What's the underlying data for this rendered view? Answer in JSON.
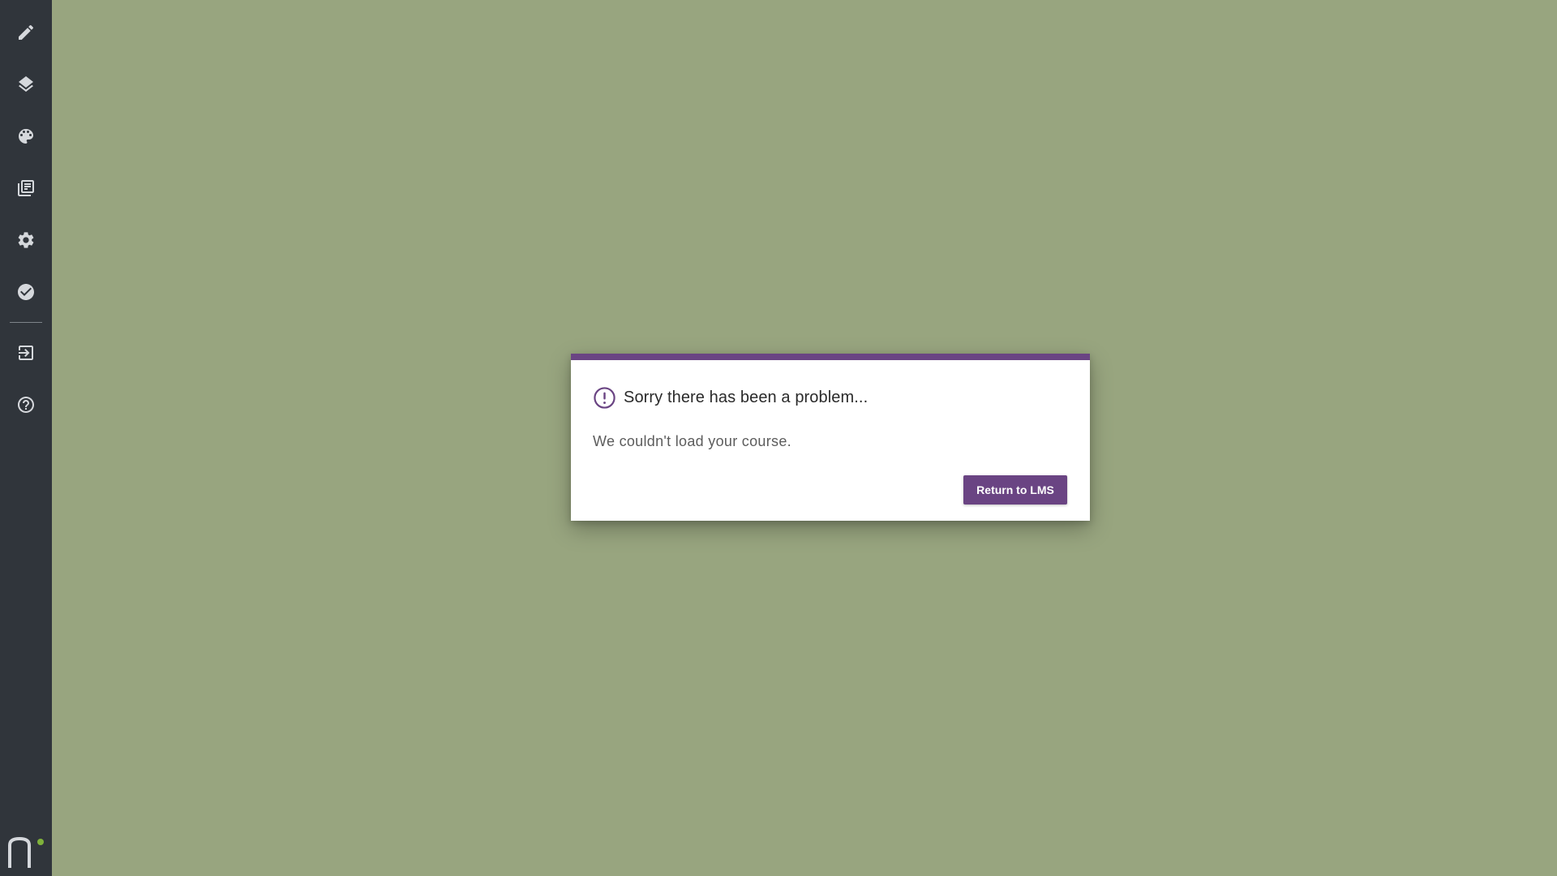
{
  "colors": {
    "canvas_bg": "#98a57f",
    "sidebar_bg": "#30353b",
    "accent": "#6a4483",
    "status_dot": "#7fb23b"
  },
  "sidebar": {
    "items": [
      {
        "icon": "pencil-icon",
        "name": "sidebar-item-edit"
      },
      {
        "icon": "layers-icon",
        "name": "sidebar-item-layers"
      },
      {
        "icon": "palette-icon",
        "name": "sidebar-item-theme"
      },
      {
        "icon": "library-icon",
        "name": "sidebar-item-library"
      },
      {
        "icon": "gear-icon",
        "name": "sidebar-item-settings"
      },
      {
        "icon": "check-circle-icon",
        "name": "sidebar-item-publish"
      },
      {
        "icon": "exit-icon",
        "name": "sidebar-item-exit"
      },
      {
        "icon": "help-icon",
        "name": "sidebar-item-help"
      }
    ],
    "logo": "n-logo-icon"
  },
  "dialog": {
    "icon": "exclamation-circle-icon",
    "title": "Sorry there has been a problem...",
    "message": "We couldn't load your course.",
    "button_label": "Return to LMS"
  }
}
